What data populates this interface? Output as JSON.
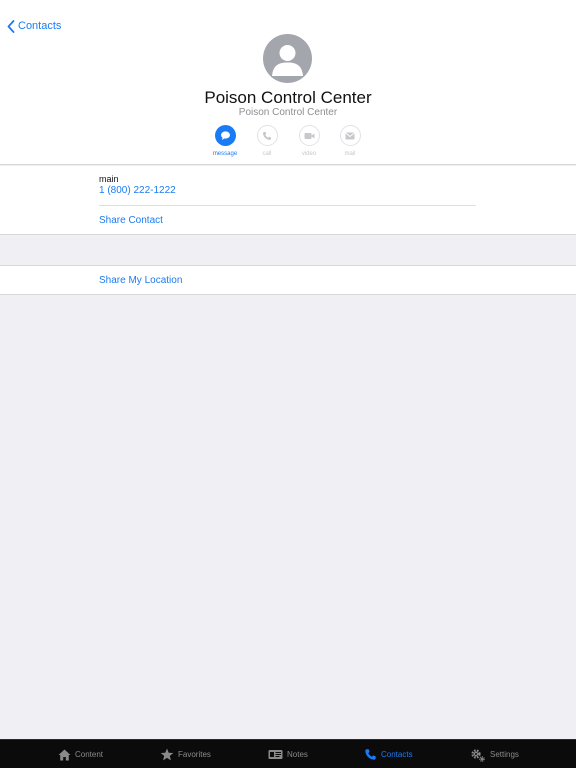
{
  "nav": {
    "back_label": "Contacts"
  },
  "contact": {
    "name": "Poison Control Center",
    "subtitle": "Poison Control Center"
  },
  "actions": [
    {
      "label": "message",
      "icon": "message-icon",
      "enabled": true
    },
    {
      "label": "call",
      "icon": "phone-icon",
      "enabled": false
    },
    {
      "label": "video",
      "icon": "video-icon",
      "enabled": false
    },
    {
      "label": "mail",
      "icon": "mail-icon",
      "enabled": false
    }
  ],
  "details": {
    "phone_type": "main",
    "phone_number": "1 (800) 222-1222",
    "share_contact": "Share Contact",
    "share_location": "Share My Location"
  },
  "tabbar": {
    "tabs": [
      {
        "label": "Content",
        "icon": "home-icon"
      },
      {
        "label": "Favorites",
        "icon": "star-icon"
      },
      {
        "label": "Notes",
        "icon": "notes-icon"
      },
      {
        "label": "Contacts",
        "icon": "phone-icon"
      },
      {
        "label": "Settings",
        "icon": "gear-icon"
      }
    ],
    "active": "Contacts"
  },
  "colors": {
    "accent": "#1a7cf5",
    "background": "#efeff4",
    "tabbar_background": "#0b0b0b"
  }
}
